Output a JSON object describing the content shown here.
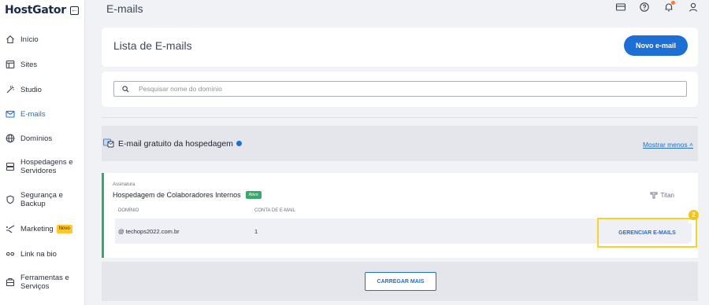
{
  "brand": {
    "logo_text": "HostGator",
    "logo_icon": "arrow-left-box-icon"
  },
  "sidebar": {
    "items": [
      {
        "label": "Início",
        "icon": "home-icon"
      },
      {
        "label": "Sites",
        "icon": "browser-window-icon"
      },
      {
        "label": "Studio",
        "icon": "sparkle-icon"
      },
      {
        "label": "E-mails",
        "icon": "mail-icon",
        "active": true
      },
      {
        "label": "Domínios",
        "icon": "globe-icon"
      },
      {
        "label": "Hospedagens e Servidores",
        "icon": "server-icon"
      },
      {
        "label": "Segurança e Backup",
        "icon": "shield-icon"
      },
      {
        "label": "Marketing",
        "icon": "megaphone-icon",
        "badge": "Novo"
      },
      {
        "label": "Link na bio",
        "icon": "link-icon"
      },
      {
        "label": "Ferramentas e Serviços",
        "icon": "tools-icon"
      }
    ]
  },
  "topbar": {
    "title": "E-mails",
    "icons": [
      "billing-card-icon",
      "help-icon",
      "notification-bell-icon",
      "user-icon"
    ]
  },
  "email_list": {
    "title": "Lista de E-mails",
    "new_button": "Novo e-mail",
    "search_placeholder": "Pesquisar nome do domínio"
  },
  "free_email": {
    "title": "E-mail gratuito da hospedagem",
    "toggle_label": "Mostrar menos",
    "subscription_label": "Assinatura",
    "subscription_name": "Hospedagem de Colaboradores Internos",
    "status": "Ativo",
    "provider": "Titan",
    "columns": [
      "DOMÍNIO",
      "CONTA DE E-MAIL"
    ],
    "rows": [
      {
        "domain": "@ techops2022.com.br",
        "accounts": "1",
        "action": "GERENCIAR E-MAILS"
      }
    ],
    "step_number": "2"
  },
  "load_more": "CARREGAR MAIS",
  "colors": {
    "accent": "#1d6fd6",
    "active_badge": "#3aa86b",
    "highlight": "#f5d328",
    "new_badge": "#ffc72c"
  }
}
